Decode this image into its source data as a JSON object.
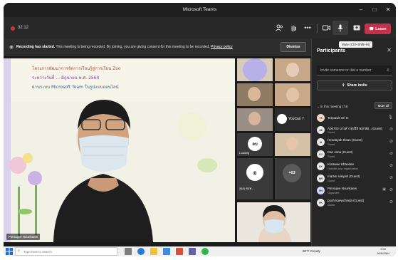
{
  "window": {
    "title": "Microsoft Teams"
  },
  "toolbar": {
    "timer": "32:12",
    "leave_label": "Leave",
    "mic_tooltip": "Mute (Ctrl+Shift+M)"
  },
  "banner": {
    "bold_text": "Recording has started.",
    "text": " This meeting is being recorded. By joining, you are giving consent for this meeting to be recorded.",
    "link": "Privacy policy",
    "dismiss_label": "Dismiss"
  },
  "stage": {
    "presenter_name": "Pimsujee Nounkaew",
    "slide_lines": [
      "โครงการพัฒนาการจัดการเรียนรู้สู่การเรียน Zoo",
      "ระหว่างวันที่ ... มิถุนายน พ.ศ. 2564",
      "ผ่านระบบ Microsoft Team ในรูปแบบออนไลน์"
    ],
    "tiles": [
      {
        "name": ""
      },
      {
        "name": ""
      },
      {
        "name": ""
      },
      {
        "name": ""
      },
      {
        "name": ""
      },
      {
        "name": "YouCan 7"
      },
      {
        "name": ""
      },
      {
        "name": "",
        "avatar": "ลบ",
        "caption": "Loading"
      },
      {
        "name": "",
        "avatar": "อ",
        "caption": "อรุณ ซอฟ..."
      },
      {
        "name": "",
        "more": "+63"
      }
    ]
  },
  "panel": {
    "title": "Participants",
    "invite_placeholder": "Invite someone or dial a number",
    "share_invite_label": "Share invite",
    "section_label": "In this meeting (74)",
    "mute_all_label": "Mute all",
    "participants": [
      {
        "initials": "TS",
        "name": "Teepawit Sri In",
        "sub": "",
        "avatar_color": "#f2d7c9"
      },
      {
        "initials": "A6",
        "name": "A06703 นางสาวสุปรีย์ พฤกษ์ฤ...(Guest)",
        "sub": "Guest",
        "avatar_color": "#e9e9e9"
      },
      {
        "initials": "HI",
        "name": "Heedayah Ihsan (Guest)",
        "sub": "Guest",
        "avatar_color": "#e9e9e9"
      },
      {
        "initials": "KJ",
        "name": "Kan Jana (Guest)",
        "sub": "Guest",
        "avatar_color": "#e9e9e9"
      },
      {
        "initials": "KK",
        "name": "Korawee Khaodee",
        "sub": "Outside your organization",
        "avatar_color": "#e9e9e9"
      },
      {
        "initials": "MR",
        "name": "ma'am rukiyah (Guest)",
        "sub": "Guest",
        "avatar_color": "#e9e9e9"
      },
      {
        "initials": "PN",
        "name": "Pimsujee Nounkaew",
        "sub": "Organizer",
        "avatar_color": "#cfd8f5"
      },
      {
        "initials": "PK",
        "name": "pooh kaewchinda (Guest)",
        "sub": "Guest",
        "avatar_color": "#e9e9e9"
      }
    ]
  },
  "taskbar": {
    "search_placeholder": "Type here to search",
    "weather": "80°F  Cloudy",
    "time": "9:00",
    "date": "26/8/2564"
  },
  "colors": {
    "leave": "#c4314b",
    "recording": "#d13438",
    "accent": "#6264a7"
  }
}
